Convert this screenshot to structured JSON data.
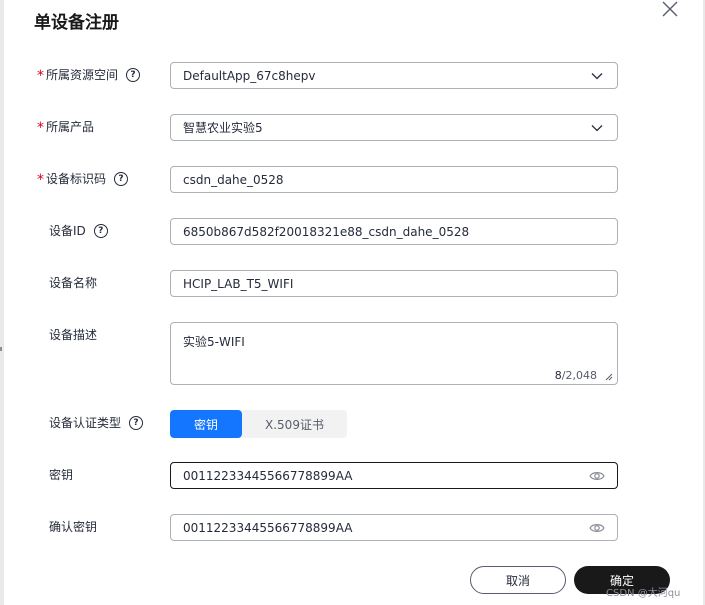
{
  "dialog": {
    "title": "单设备注册"
  },
  "form": {
    "resource_space": {
      "label": "所属资源空间",
      "required": true,
      "value": "DefaultApp_67c8hepv"
    },
    "product": {
      "label": "所属产品",
      "required": true,
      "value": "智慧农业实验5"
    },
    "node_id": {
      "label": "设备标识码",
      "required": true,
      "value": "csdn_dahe_0528"
    },
    "device_id": {
      "label": "设备ID",
      "value": "6850b867d582f20018321e88_csdn_dahe_0528"
    },
    "device_name": {
      "label": "设备名称",
      "value": "HCIP_LAB_T5_WIFI"
    },
    "description": {
      "label": "设备描述",
      "value": "实验5-WIFI",
      "count": "8",
      "max": "/2,048"
    },
    "auth_type": {
      "label": "设备认证类型",
      "options": [
        "密钥",
        "X.509证书"
      ],
      "selected": "密钥"
    },
    "secret": {
      "label": "密钥",
      "value": "00112233445566778899AA"
    },
    "confirm_secret": {
      "label": "确认密钥",
      "value": "00112233445566778899AA"
    }
  },
  "footer": {
    "cancel_label": "取消",
    "ok_label": "确定"
  },
  "watermark": "CSDN @大河qu",
  "colors": {
    "primary": "#1475ff",
    "required": "#d9001b",
    "dark_button": "#191919"
  }
}
